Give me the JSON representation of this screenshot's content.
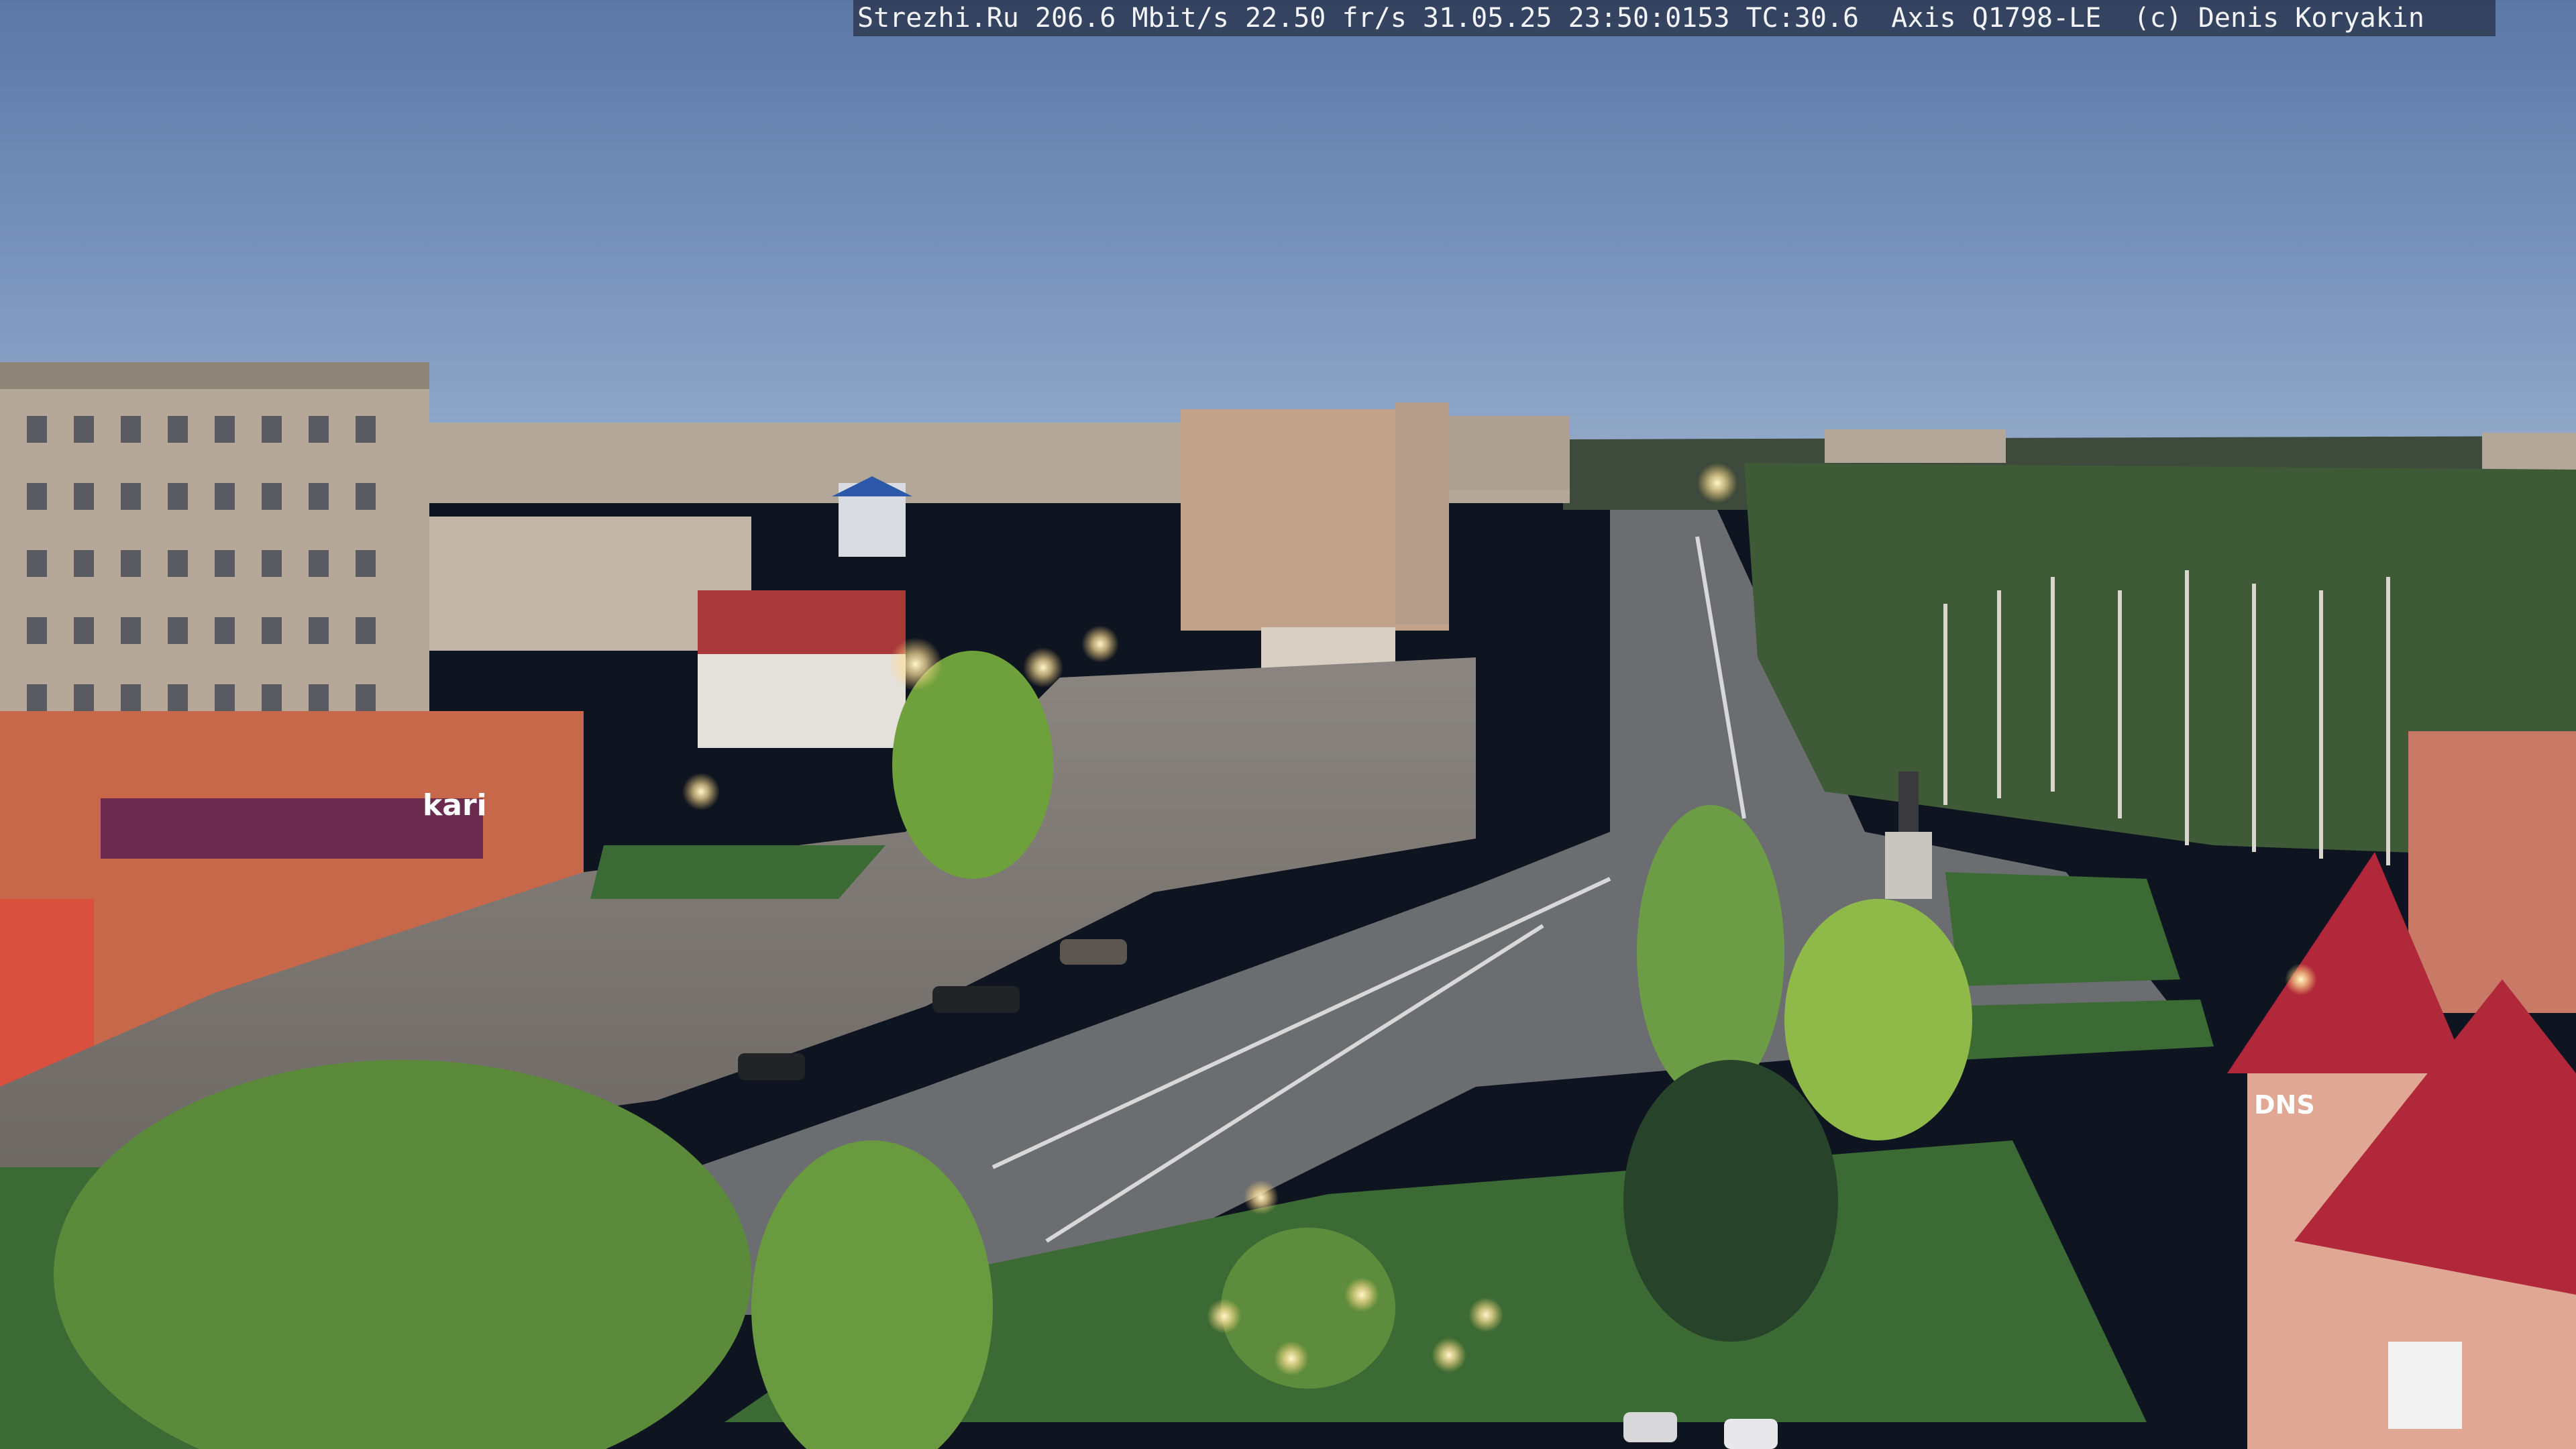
{
  "camera_overlay": {
    "text": "Strezhi.Ru 206.6 Mbit/s 22.50 fr/s 31.05.25 23:50:0153 TC:30.6  Axis Q1798-LE  (c) Denis Koryakin"
  },
  "signage": {
    "store_sign": "kari",
    "tower_sign": "DNS"
  },
  "palette": {
    "sky_top": "#5d79a8",
    "sky_horizon": "#8ea6c6",
    "building_panel": "#b8ab9c",
    "brick_red": "#c8684a",
    "roof_red": "#b0283a",
    "grass": "#3c6a34",
    "road": "#6e6f72",
    "lamp_glow": "#ffe9a8"
  }
}
